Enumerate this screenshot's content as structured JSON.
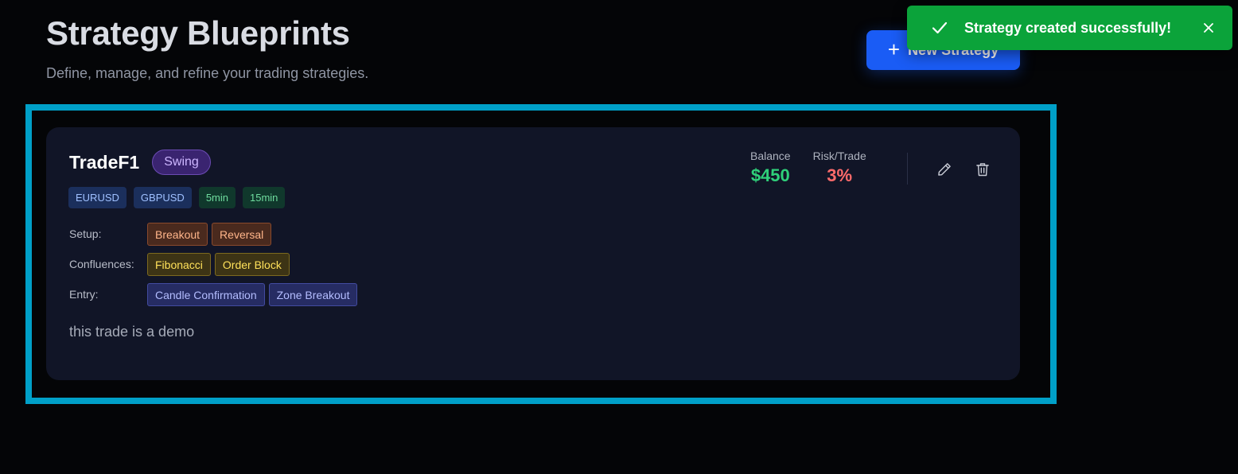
{
  "header": {
    "title": "Strategy Blueprints",
    "subtitle": "Define, manage, and refine your trading strategies.",
    "new_button_label": "New Strategy"
  },
  "toast": {
    "message": "Strategy created successfully!",
    "icon": "check-icon",
    "close_icon": "close-icon",
    "color": "#0ba33a"
  },
  "strategy": {
    "name": "TradeF1",
    "style": "Swing",
    "pairs": [
      "EURUSD",
      "GBPUSD"
    ],
    "timeframes": [
      "5min",
      "15min"
    ],
    "setup_label": "Setup:",
    "setup": [
      "Breakout",
      "Reversal"
    ],
    "confluences_label": "Confluences:",
    "confluences": [
      "Fibonacci",
      "Order Block"
    ],
    "entry_label": "Entry:",
    "entry": [
      "Candle Confirmation",
      "Zone Breakout"
    ],
    "notes": "this trade is a demo",
    "balance_label": "Balance",
    "balance": "$450",
    "risk_label": "Risk/Trade",
    "risk": "3%",
    "edit_icon": "pencil-icon",
    "delete_icon": "trash-icon"
  },
  "colors": {
    "accent": "#1a5cf5",
    "highlight": "#00a0c8",
    "balance": "#2fd07a",
    "risk": "#ff6b6b"
  }
}
